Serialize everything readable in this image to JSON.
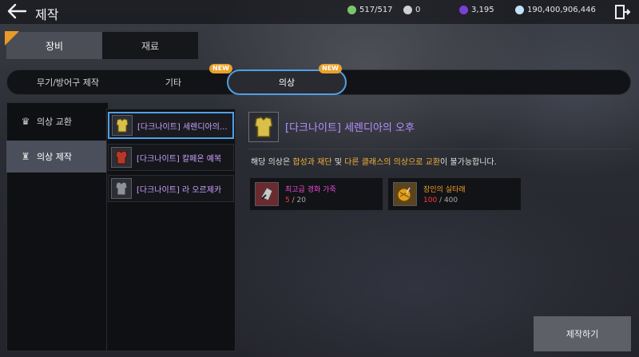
{
  "header": {
    "title": "제작",
    "resources": [
      {
        "icon": "energy-icon",
        "value": "517/517",
        "color": "#7cc46b"
      },
      {
        "icon": "pearl-icon",
        "value": "0",
        "color": "#cfcfd6"
      },
      {
        "icon": "gem-icon",
        "value": "3,195",
        "color": "#7a3fd6"
      },
      {
        "icon": "silver-icon",
        "value": "190,400,906,446",
        "color": "#bfe3f7"
      }
    ]
  },
  "main_tabs": [
    {
      "label": "장비",
      "active": true
    },
    {
      "label": "재료",
      "active": false
    }
  ],
  "sub_tabs": [
    {
      "label": "무기/방어구 제작",
      "new": false
    },
    {
      "label": "기타",
      "new": true
    },
    {
      "label": "의상",
      "new": true,
      "active": true
    }
  ],
  "new_badge": "NEW",
  "corner_new": "NEW",
  "sidebar": [
    {
      "label": "의상 교환",
      "icon": "crown-icon"
    },
    {
      "label": "의상 제작",
      "icon": "anvil-icon",
      "active": true
    }
  ],
  "list": [
    {
      "label": "[다크나이트] 세렌디아의...",
      "icon": "yellow-armor-icon"
    },
    {
      "label": "[다크나이트] 칼페온 예복",
      "icon": "red-armor-icon"
    },
    {
      "label": "[다크나이트] 라 오르제카",
      "icon": "silver-armor-icon"
    }
  ],
  "detail": {
    "name": "[다크나이트] 세렌디아의 오후",
    "desc_prefix": "해당 의상은 ",
    "desc_hl1": "합성과 재단",
    "desc_mid": " 및 ",
    "desc_hl2": "다른 클래스의 의상으로 교환",
    "desc_suffix": "이 불가능합니다."
  },
  "materials": [
    {
      "name": "최고급 경화 가죽",
      "have": "5",
      "need": "20",
      "name_color": "#e84bd4",
      "icon": "leather-icon"
    },
    {
      "name": "장인의 실타래",
      "have": "100",
      "need": "400",
      "name_color": "#f0a020",
      "icon": "thread-icon"
    }
  ],
  "craft_button": "제작하기"
}
